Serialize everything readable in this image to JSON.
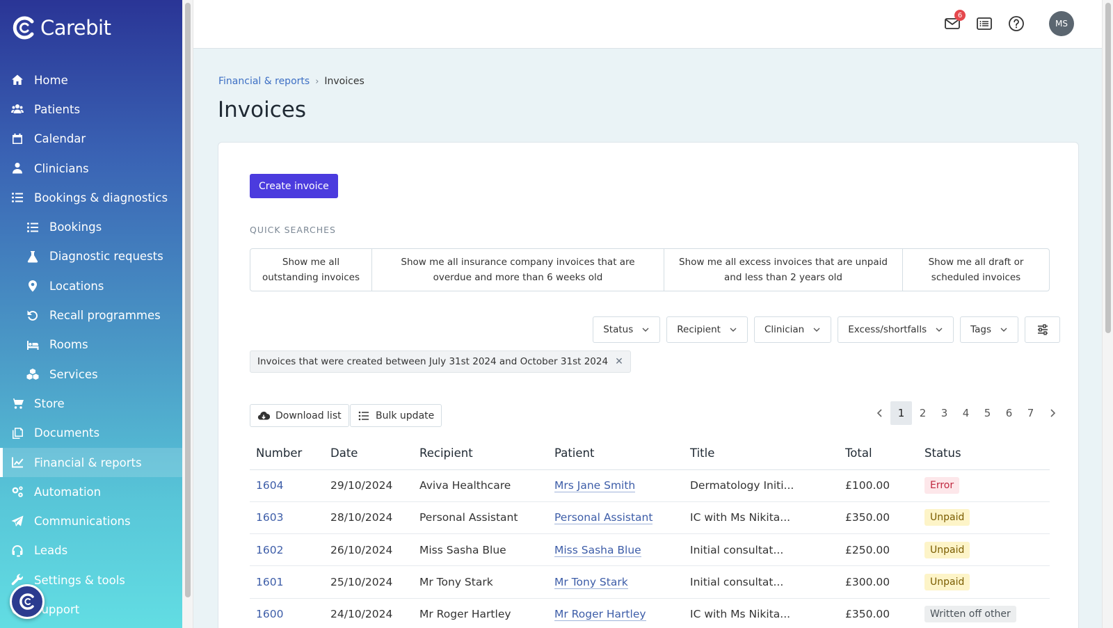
{
  "app": {
    "name": "Carebit"
  },
  "sidebar": {
    "items": [
      {
        "label": "Home",
        "icon": "home-icon",
        "sub": false,
        "active": false
      },
      {
        "label": "Patients",
        "icon": "users-icon",
        "sub": false,
        "active": false
      },
      {
        "label": "Calendar",
        "icon": "calendar-icon",
        "sub": false,
        "active": false
      },
      {
        "label": "Clinicians",
        "icon": "clinician-icon",
        "sub": false,
        "active": false
      },
      {
        "label": "Bookings & diagnostics",
        "icon": "list-icon",
        "sub": false,
        "active": false
      },
      {
        "label": "Bookings",
        "icon": "list-icon",
        "sub": true,
        "active": false
      },
      {
        "label": "Diagnostic requests",
        "icon": "flask-icon",
        "sub": true,
        "active": false
      },
      {
        "label": "Locations",
        "icon": "map-pin-icon",
        "sub": true,
        "active": false
      },
      {
        "label": "Recall programmes",
        "icon": "undo-icon",
        "sub": true,
        "active": false
      },
      {
        "label": "Rooms",
        "icon": "bed-icon",
        "sub": true,
        "active": false
      },
      {
        "label": "Services",
        "icon": "cubes-icon",
        "sub": true,
        "active": false
      },
      {
        "label": "Store",
        "icon": "cart-icon",
        "sub": false,
        "active": false
      },
      {
        "label": "Documents",
        "icon": "documents-icon",
        "sub": false,
        "active": false
      },
      {
        "label": "Financial & reports",
        "icon": "chart-line-icon",
        "sub": false,
        "active": true
      },
      {
        "label": "Automation",
        "icon": "cogs-icon",
        "sub": false,
        "active": false
      },
      {
        "label": "Communications",
        "icon": "paper-plane-icon",
        "sub": false,
        "active": false
      },
      {
        "label": "Leads",
        "icon": "headset-icon",
        "sub": false,
        "active": false
      },
      {
        "label": "Settings & tools",
        "icon": "wrench-icon",
        "sub": false,
        "active": false
      },
      {
        "label": "Support",
        "icon": "support-icon",
        "sub": false,
        "active": false
      }
    ]
  },
  "topbar": {
    "notification_count": "6",
    "avatar_initials": "MS"
  },
  "breadcrumb": {
    "parent": "Financial & reports",
    "current": "Invoices"
  },
  "page": {
    "title": "Invoices"
  },
  "actions": {
    "create_invoice": "Create invoice"
  },
  "quick_searches": {
    "label": "QUICK SEARCHES",
    "items": [
      "Show me all outstanding invoices",
      "Show me all insurance company invoices that are overdue and more than 6 weeks old",
      "Show me all excess invoices that are unpaid and less than 2 years old",
      "Show me all draft or scheduled invoices"
    ]
  },
  "filters": [
    "Status",
    "Recipient",
    "Clinician",
    "Excess/shortfalls",
    "Tags"
  ],
  "active_filter": "Invoices that were created between July 31st 2024 and October 31st 2024",
  "toolbar": {
    "download": "Download list",
    "bulk": "Bulk update"
  },
  "pagination": {
    "pages": [
      "1",
      "2",
      "3",
      "4",
      "5",
      "6",
      "7"
    ],
    "current": "1"
  },
  "table": {
    "headers": [
      "Number",
      "Date",
      "Recipient",
      "Patient",
      "Title",
      "Total",
      "Status"
    ],
    "rows": [
      {
        "number": "1604",
        "date": "29/10/2024",
        "recipient": "Aviva Healthcare",
        "patient": "Mrs Jane Smith",
        "title": "Dermatology Initi...",
        "total": "£100.00",
        "status": "Error",
        "status_kind": "error"
      },
      {
        "number": "1603",
        "date": "28/10/2024",
        "recipient": "Personal Assistant",
        "patient": "Personal Assistant",
        "title": "IC with Ms Nikita...",
        "total": "£350.00",
        "status": "Unpaid",
        "status_kind": "unpaid"
      },
      {
        "number": "1602",
        "date": "26/10/2024",
        "recipient": "Miss Sasha Blue",
        "patient": "Miss Sasha Blue",
        "title": "Initial consultat...",
        "total": "£250.00",
        "status": "Unpaid",
        "status_kind": "unpaid"
      },
      {
        "number": "1601",
        "date": "25/10/2024",
        "recipient": "Mr Tony Stark",
        "patient": "Mr Tony Stark",
        "title": "Initial consultat...",
        "total": "£300.00",
        "status": "Unpaid",
        "status_kind": "unpaid"
      },
      {
        "number": "1600",
        "date": "24/10/2024",
        "recipient": "Mr Roger Hartley",
        "patient": "Mr Roger Hartley",
        "title": "IC with Ms Nikita...",
        "total": "£350.00",
        "status": "Written off other",
        "status_kind": "other"
      }
    ]
  },
  "colors": {
    "primary": "#4b3bde",
    "link": "#3d5da8",
    "sidebar_top": "#2a3596",
    "sidebar_bottom": "#62dde3"
  }
}
